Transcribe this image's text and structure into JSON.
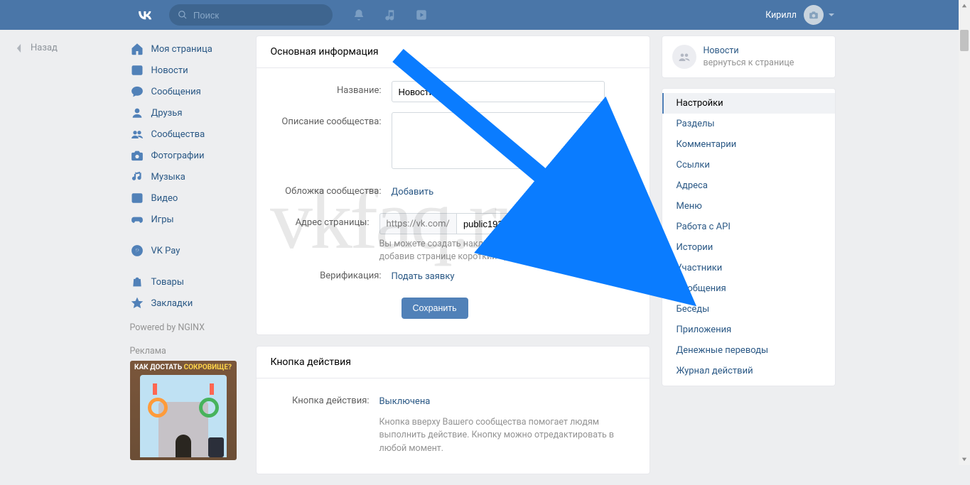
{
  "topbar": {
    "search_placeholder": "Поиск",
    "username": "Кирилл"
  },
  "back_label": "Назад",
  "leftnav": {
    "items": [
      "Моя страница",
      "Новости",
      "Сообщения",
      "Друзья",
      "Сообщества",
      "Фотографии",
      "Музыка",
      "Видео",
      "Игры"
    ],
    "vkpay": "VK Pay",
    "extra": [
      "Товары",
      "Закладки"
    ],
    "powered": "Powered by NGINX",
    "reklama": "Реклама",
    "ad_title_a": "КАК ДОСТАТЬ ",
    "ad_title_b": "СОКРОВИЩЕ?"
  },
  "main": {
    "header": "Основная информация",
    "name_label": "Название:",
    "name_value": "Новости",
    "desc_label": "Описание сообщества:",
    "desc_value": "",
    "cover_label": "Обложка сообщества:",
    "cover_link": "Добавить",
    "addr_label": "Адрес страницы:",
    "addr_prefix": "https://vk.com/",
    "addr_value": "public192759560",
    "addr_hint": "Вы можете создать наклейки для Вашего сообщества, добавив странице короткий адрес.",
    "verify_label": "Верификация:",
    "verify_link": "Подать заявку",
    "save": "Сохранить"
  },
  "action": {
    "header": "Кнопка действия",
    "label": "Кнопка действия:",
    "value": "Выключена",
    "hint": "Кнопка вверху Вашего сообщества помогает людям выполнить действие. Кнопку можно отредактировать в любой момент."
  },
  "rhead": {
    "title": "Новости",
    "sub": "вернуться к странице"
  },
  "rmenu": [
    "Настройки",
    "Разделы",
    "Комментарии",
    "Ссылки",
    "Адреса",
    "Меню",
    "Работа с API",
    "Истории",
    "Участники",
    "Сообщения",
    "Беседы",
    "Приложения",
    "Денежные переводы",
    "Журнал действий"
  ],
  "watermark": "vkfaq.ru"
}
